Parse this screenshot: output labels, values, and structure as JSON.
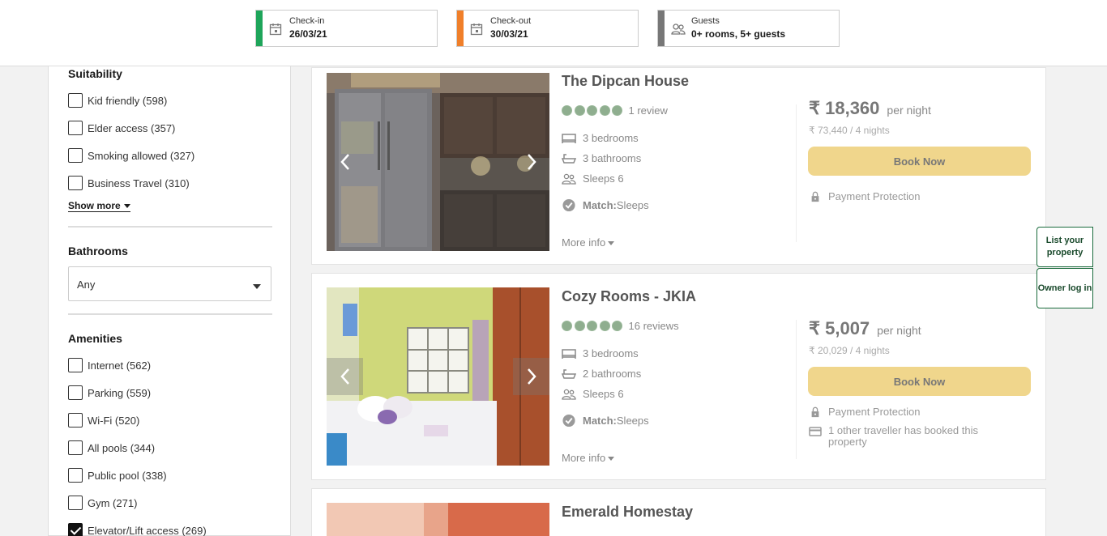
{
  "search": {
    "checkin": {
      "label": "Check-in",
      "value": "26/03/21",
      "color": "#1ea55a"
    },
    "checkout": {
      "label": "Check-out",
      "value": "30/03/21",
      "color": "#f07f2a"
    },
    "guests": {
      "label": "Guests",
      "value": "0+ rooms, 5+ guests",
      "color": "#777777"
    }
  },
  "sidebar": {
    "suitability": {
      "title": "Suitability",
      "items": [
        {
          "label": "Kid friendly (598)",
          "checked": false
        },
        {
          "label": "Elder access (357)",
          "checked": false
        },
        {
          "label": "Smoking allowed (327)",
          "checked": false
        },
        {
          "label": "Business Travel (310)",
          "checked": false
        }
      ],
      "show_more": "Show more"
    },
    "bathrooms": {
      "title": "Bathrooms",
      "selected": "Any"
    },
    "amenities": {
      "title": "Amenities",
      "items": [
        {
          "label": "Internet (562)",
          "checked": false
        },
        {
          "label": "Parking (559)",
          "checked": false
        },
        {
          "label": "Wi-Fi (520)",
          "checked": false
        },
        {
          "label": "All pools (344)",
          "checked": false
        },
        {
          "label": "Public pool (338)",
          "checked": false
        },
        {
          "label": "Gym (271)",
          "checked": false
        },
        {
          "label": "Elevator/Lift access (269)",
          "checked": true
        }
      ]
    }
  },
  "listings": [
    {
      "title": "The Dipcan House",
      "rating_dots": 5,
      "reviews": "1 review",
      "bedrooms": "3 bedrooms",
      "bathrooms": "3 bathrooms",
      "sleeps": "Sleeps 6",
      "match_label": "Match:",
      "match_value": " Sleeps",
      "more_info": "More info",
      "price": "₹ 18,360",
      "per": "per night",
      "total": "₹ 73,440 / 4 nights",
      "book": "Book Now",
      "perks": [
        "Payment Protection"
      ]
    },
    {
      "title": "Cozy Rooms - JKIA",
      "rating_dots": 5,
      "reviews": "16 reviews",
      "bedrooms": "3 bedrooms",
      "bathrooms": "2 bathrooms",
      "sleeps": "Sleeps 6",
      "match_label": "Match:",
      "match_value": " Sleeps",
      "more_info": "More info",
      "price": "₹ 5,007",
      "per": "per night",
      "total": "₹ 20,029 / 4 nights",
      "book": "Book Now",
      "perks": [
        "Payment Protection",
        "1 other traveller has booked this property"
      ]
    },
    {
      "title": "Emerald Homestay"
    }
  ],
  "side_tabs": {
    "list_property": "List your property",
    "owner_login": "Owner log in"
  },
  "colors": {
    "accent_green": "#1a6b3c",
    "book_button": "#f0d68c",
    "rating_dot": "#8fae8f"
  }
}
